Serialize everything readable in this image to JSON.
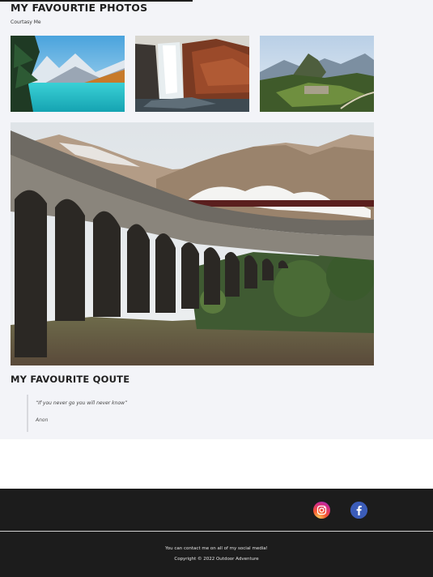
{
  "gallery": {
    "title": "MY FAVOURTIE PHOTOS",
    "credit": "Courtasy Me",
    "photos": [
      {
        "subject": "mountain-lake-photo"
      },
      {
        "subject": "waterfall-photo"
      },
      {
        "subject": "machu-picchu-photo"
      }
    ],
    "hero": {
      "subject": "viaduct-steam-train-photo"
    }
  },
  "quote_section": {
    "title": "MY FAVOURITE QOUTE",
    "quote": "“If you never go you will never know”",
    "author": "Anon"
  },
  "footer": {
    "social": [
      {
        "icon": "instagram-icon"
      },
      {
        "icon": "facebook-icon"
      }
    ],
    "contact": "You can contact me on all of my social media!",
    "copyright": "Copyright © 2022 Outdoor Adventure"
  },
  "colors": {
    "main_bg": "#f3f4f8",
    "footer_bg": "#1c1c1c",
    "facebook": "#3b5cb8"
  }
}
